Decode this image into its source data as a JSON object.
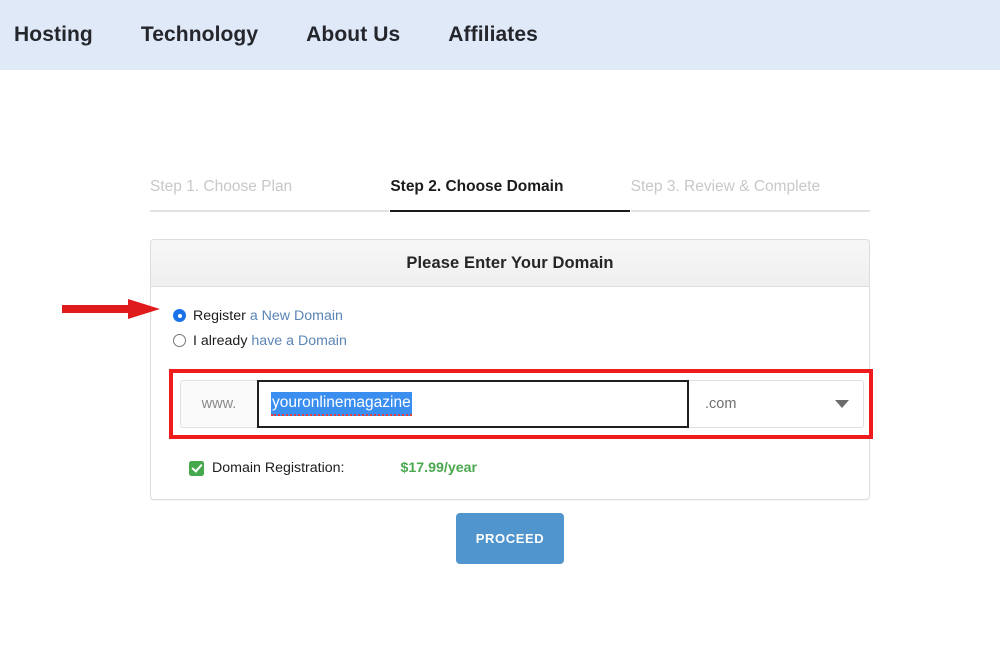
{
  "nav": {
    "items": [
      {
        "label": "Hosting"
      },
      {
        "label": "Technology"
      },
      {
        "label": "About Us"
      },
      {
        "label": "Affiliates"
      }
    ],
    "background_color": "#dfe9f8"
  },
  "steps": [
    {
      "label": "Step 1. Choose Plan",
      "state": "inactive"
    },
    {
      "label": "Step 2. Choose Domain",
      "state": "active"
    },
    {
      "label": "Step 3. Review & Complete",
      "state": "inactive"
    }
  ],
  "panel": {
    "title": "Please Enter Your Domain",
    "options": [
      {
        "label": "Register",
        "link": "a New Domain",
        "selected": true
      },
      {
        "label": "I already",
        "link": "have a Domain",
        "selected": false
      }
    ],
    "domain_input": {
      "prefix": "www.",
      "value": "youronlinemagazine",
      "placeholder": "",
      "selected": true,
      "tld": ".com",
      "tld_options": [
        ".com"
      ]
    },
    "registration": {
      "checked": true,
      "label": "Domain Registration:",
      "price": "$17.99/year",
      "price_color": "#4aa94f"
    }
  },
  "actions": {
    "proceed_label": "PROCEED",
    "proceed_color": "#5195ce"
  },
  "annotations": {
    "arrow_color": "#e01b1b",
    "box_color": "#ee1c1c"
  }
}
